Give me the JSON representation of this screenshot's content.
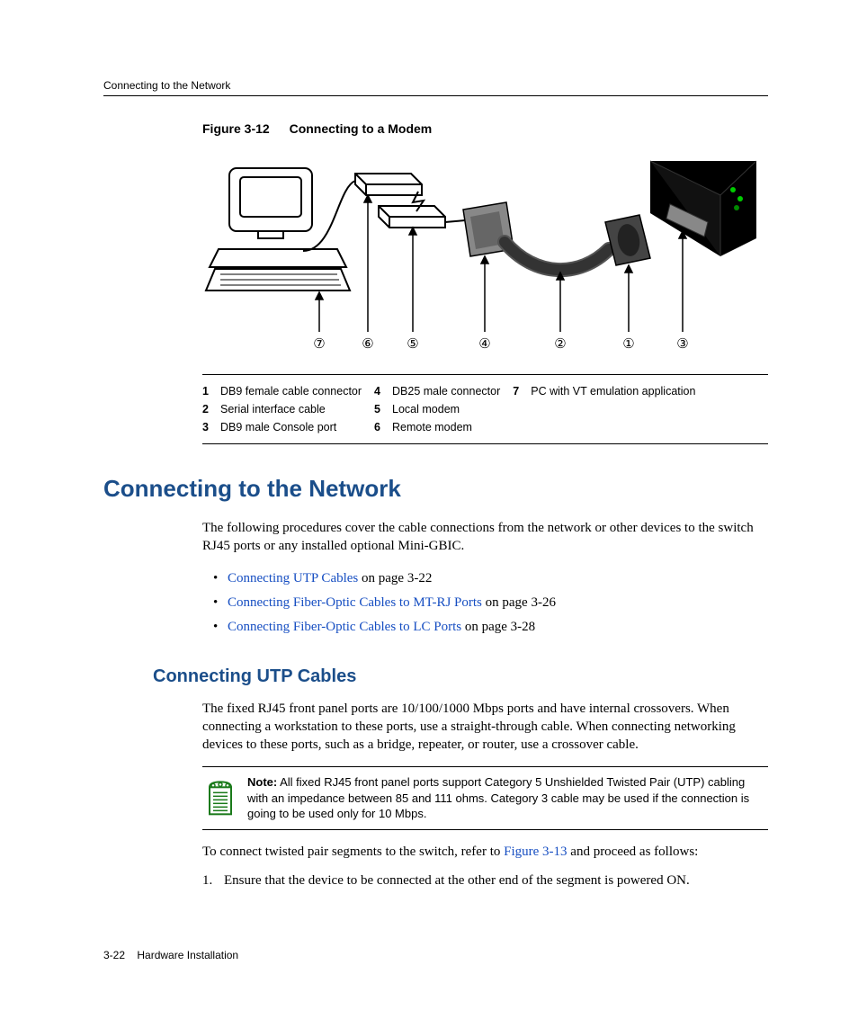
{
  "header": {
    "running_head": "Connecting to the Network"
  },
  "figure": {
    "label": "Figure 3-12",
    "title": "Connecting to a Modem",
    "callouts_visual": [
      "⑦",
      "⑥",
      "⑤",
      "④",
      "②",
      "①",
      "③"
    ],
    "legend": [
      {
        "num": "1",
        "text": "DB9 female cable connector"
      },
      {
        "num": "2",
        "text": "Serial interface cable"
      },
      {
        "num": "3",
        "text": "DB9 male Console port"
      },
      {
        "num": "4",
        "text": "DB25 male connector"
      },
      {
        "num": "5",
        "text": "Local modem"
      },
      {
        "num": "6",
        "text": "Remote modem"
      },
      {
        "num": "7",
        "text": "PC with VT emulation application"
      }
    ]
  },
  "section": {
    "heading": "Connecting to the Network",
    "intro": "The following procedures cover the cable connections from the network or other devices to the switch RJ45 ports or any installed optional Mini-GBIC.",
    "bullets": [
      {
        "link": "Connecting UTP Cables",
        "tail": " on page 3-22"
      },
      {
        "link": "Connecting Fiber-Optic Cables to MT-RJ Ports",
        "tail": " on page 3-26"
      },
      {
        "link": "Connecting Fiber-Optic Cables to LC Ports",
        "tail": " on page 3-28"
      }
    ]
  },
  "subsection": {
    "heading": "Connecting UTP Cables",
    "para1": "The fixed RJ45 front panel ports are 10/100/1000 Mbps ports and have internal crossovers. When connecting a workstation to these ports, use a straight-through cable. When connecting networking devices to these ports, such as a bridge, repeater, or router, use a crossover cable.",
    "note_label": "Note:",
    "note_text": " All fixed RJ45 front panel ports support Category 5 Unshielded Twisted Pair (UTP) cabling with an impedance between 85 and 111 ohms. Category 3 cable may be used if the connection is going to be used only for 10 Mbps.",
    "para2_pre": "To connect twisted pair segments to the switch, refer to ",
    "para2_link": "Figure 3-13",
    "para2_post": " and proceed as follows:",
    "steps": [
      {
        "num": "1.",
        "text": "Ensure that the device to be connected at the other end of the segment is powered ON."
      }
    ]
  },
  "footer": {
    "page": "3-22",
    "chapter": "Hardware Installation"
  }
}
